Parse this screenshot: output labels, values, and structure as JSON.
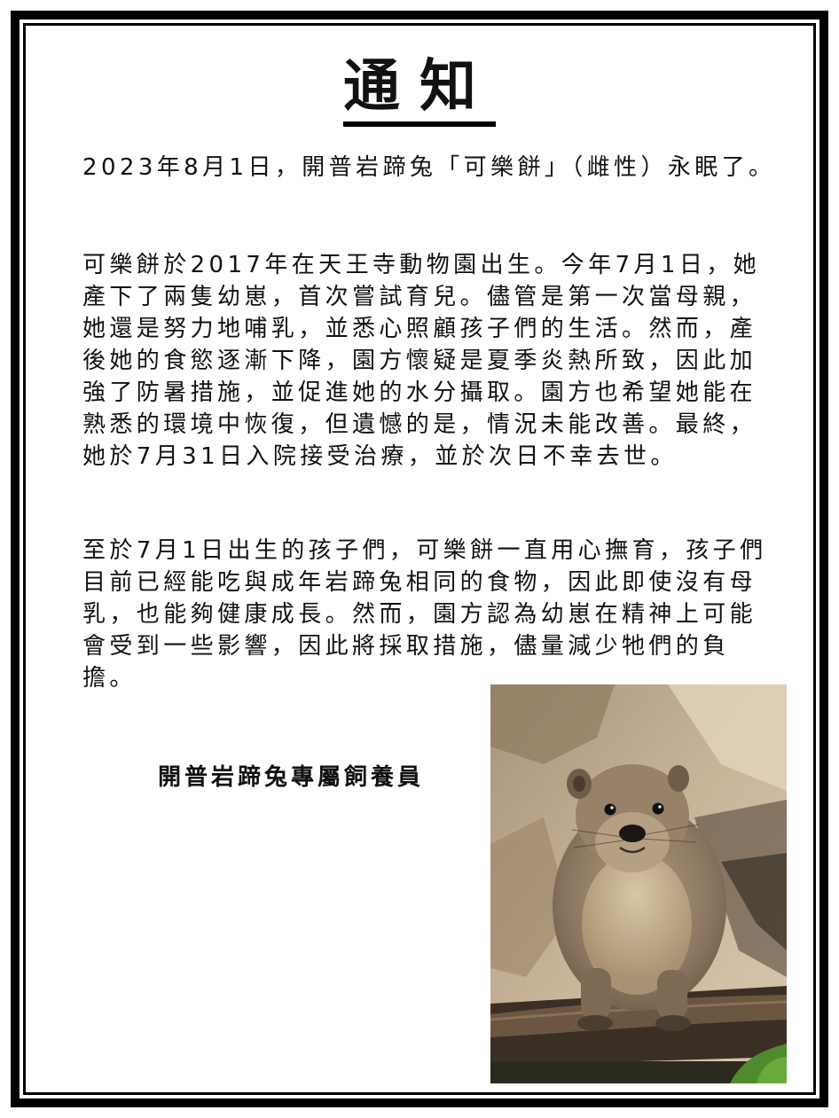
{
  "notice": {
    "title": "通知",
    "paragraphs": [
      "2023年8月1日，開普岩蹄兔「可樂餅」（雌性）永眠了。",
      "可樂餅於2017年在天王寺動物園出生。今年7月1日，她產下了兩隻幼崽，首次嘗試育兒。儘管是第一次當母親，她還是努力地哺乳，並悉心照顧孩子們的生活。然而，產後她的食慾逐漸下降，園方懷疑是夏季炎熱所致，因此加強了防暑措施，並促進她的水分攝取。園方也希望她能在熟悉的環境中恢復，但遺憾的是，情況未能改善。最終，她於7月31日入院接受治療，並於次日不幸去世。",
      "至於7月1日出生的孩子們，可樂餅一直用心撫育，孩子們目前已經能吃與成年岩蹄兔相同的食物，因此即使沒有母乳，也能夠健康成長。然而，園方認為幼崽在精神上可能會受到一些影響，因此將採取措施，儘量減少牠們的負擔。"
    ],
    "signature": "開普岩蹄兔專屬飼養員"
  },
  "photo": {
    "subject": "rock hyrax on a log",
    "colors": {
      "rock": "#b8a489",
      "fur": "#8e7a62",
      "log": "#5a4634",
      "leaf": "#4f8a2e"
    }
  },
  "colors": {
    "border": "#000000",
    "text": "#111111",
    "background": "#ffffff"
  }
}
